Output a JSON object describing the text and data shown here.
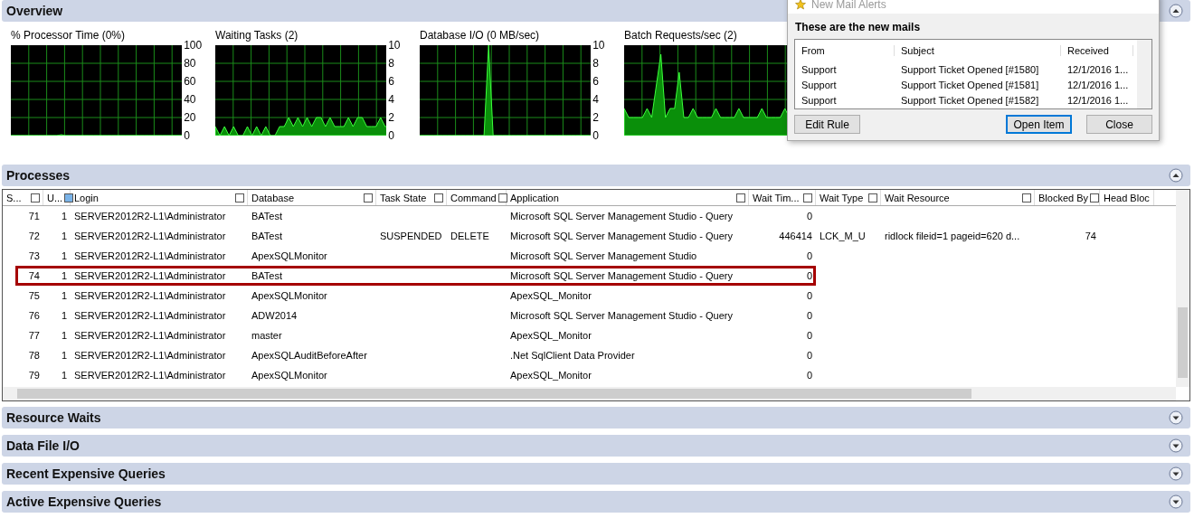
{
  "overview": {
    "title": "Overview",
    "expanded": true,
    "charts": [
      {
        "title": "% Processor Time (0%)",
        "chart_data": {
          "type": "area",
          "grid": true,
          "ylim": [
            0,
            100
          ],
          "yticks": [
            {
              "value": 100,
              "label": "100"
            },
            {
              "value": 80,
              "label": "80"
            },
            {
              "value": 60,
              "label": "60"
            },
            {
              "value": 40,
              "label": "40"
            },
            {
              "value": 20,
              "label": "20"
            },
            {
              "value": 0,
              "label": "0"
            }
          ],
          "values": [
            0,
            0,
            0,
            0,
            0,
            0,
            0,
            0,
            0,
            0,
            0,
            1,
            0,
            0,
            0,
            0,
            0,
            0,
            0,
            0,
            0,
            0,
            0,
            0,
            0,
            0,
            0,
            0,
            0,
            0,
            0,
            0,
            0,
            0,
            0,
            0,
            0,
            0,
            0,
            0
          ]
        }
      },
      {
        "title": "Waiting Tasks (2)",
        "chart_data": {
          "type": "area",
          "grid": true,
          "ylim": [
            0,
            10
          ],
          "yticks": [
            {
              "value": 10,
              "label": "10"
            },
            {
              "value": 8,
              "label": "8"
            },
            {
              "value": 6,
              "label": "6"
            },
            {
              "value": 4,
              "label": "4"
            },
            {
              "value": 2,
              "label": "2"
            },
            {
              "value": 0,
              "label": "0"
            }
          ],
          "values": [
            1,
            0,
            1,
            0,
            1,
            0,
            0,
            1,
            0,
            1,
            0,
            1,
            0,
            0,
            1,
            1,
            2,
            1,
            2,
            1,
            2,
            1,
            2,
            2,
            1,
            2,
            1,
            1,
            1,
            2,
            1,
            2,
            2,
            1,
            1,
            1,
            2,
            1,
            1,
            2
          ]
        }
      },
      {
        "title": "Database I/O (0 MB/sec)",
        "chart_data": {
          "type": "area",
          "grid": true,
          "ylim": [
            0,
            10
          ],
          "yticks": [
            {
              "value": 10,
              "label": "10"
            },
            {
              "value": 8,
              "label": "8"
            },
            {
              "value": 6,
              "label": "6"
            },
            {
              "value": 4,
              "label": "4"
            },
            {
              "value": 2,
              "label": "2"
            },
            {
              "value": 0,
              "label": "0"
            }
          ],
          "values": [
            0,
            0,
            0,
            0,
            0,
            0,
            0,
            0,
            0,
            0,
            0,
            0,
            0,
            0,
            0,
            10,
            0,
            0,
            0,
            0,
            0,
            0,
            0,
            0,
            0,
            0,
            0,
            0,
            0,
            0,
            0,
            0,
            0,
            0,
            0,
            0,
            0,
            0,
            0,
            0
          ]
        }
      },
      {
        "title": "Batch Requests/sec (2)"
      }
    ]
  },
  "processes": {
    "title": "Processes",
    "expanded": true,
    "columns": [
      {
        "label": "S...",
        "filter_active": false
      },
      {
        "label": "U...",
        "filter_active": true
      },
      {
        "label": "Login",
        "filter_active": false
      },
      {
        "label": "Database",
        "filter_active": false
      },
      {
        "label": "Task State",
        "filter_active": false
      },
      {
        "label": "Command",
        "filter_active": false
      },
      {
        "label": "Application",
        "filter_active": false
      },
      {
        "label": "Wait Tim...",
        "filter_active": false
      },
      {
        "label": "Wait Type",
        "filter_active": false
      },
      {
        "label": "Wait Resource",
        "filter_active": false
      },
      {
        "label": "Blocked By",
        "filter_active": false
      },
      {
        "label": "Head Bloc"
      }
    ],
    "rows": [
      {
        "highlighted": false,
        "cells": [
          "71",
          "1",
          "SERVER2012R2-L1\\Administrator",
          "BATest",
          "",
          "",
          "Microsoft SQL Server Management Studio - Query",
          "0",
          "",
          "",
          "",
          ""
        ]
      },
      {
        "highlighted": false,
        "cells": [
          "72",
          "1",
          "SERVER2012R2-L1\\Administrator",
          "BATest",
          "SUSPENDED",
          "DELETE",
          "Microsoft SQL Server Management Studio - Query",
          "446414",
          "LCK_M_U",
          "ridlock fileid=1 pageid=620 d...",
          "74",
          ""
        ]
      },
      {
        "highlighted": false,
        "cells": [
          "73",
          "1",
          "SERVER2012R2-L1\\Administrator",
          "ApexSQLMonitor",
          "",
          "",
          "Microsoft SQL Server Management Studio",
          "0",
          "",
          "",
          "",
          ""
        ]
      },
      {
        "highlighted": true,
        "cells": [
          "74",
          "1",
          "SERVER2012R2-L1\\Administrator",
          "BATest",
          "",
          "",
          "Microsoft SQL Server Management Studio - Query",
          "0",
          "",
          "",
          "",
          ""
        ]
      },
      {
        "highlighted": false,
        "cells": [
          "75",
          "1",
          "SERVER2012R2-L1\\Administrator",
          "ApexSQLMonitor",
          "",
          "",
          "ApexSQL_Monitor",
          "0",
          "",
          "",
          "",
          ""
        ]
      },
      {
        "highlighted": false,
        "cells": [
          "76",
          "1",
          "SERVER2012R2-L1\\Administrator",
          "ADW2014",
          "",
          "",
          "Microsoft SQL Server Management Studio - Query",
          "0",
          "",
          "",
          "",
          ""
        ]
      },
      {
        "highlighted": false,
        "cells": [
          "77",
          "1",
          "SERVER2012R2-L1\\Administrator",
          "master",
          "",
          "",
          "ApexSQL_Monitor",
          "0",
          "",
          "",
          "",
          ""
        ]
      },
      {
        "highlighted": false,
        "cells": [
          "78",
          "1",
          "SERVER2012R2-L1\\Administrator",
          "ApexSQLAuditBeforeAfter",
          "",
          "",
          ".Net SqlClient Data Provider",
          "0",
          "",
          "",
          "",
          ""
        ]
      },
      {
        "highlighted": false,
        "cells": [
          "79",
          "1",
          "SERVER2012R2-L1\\Administrator",
          "ApexSQLMonitor",
          "",
          "",
          "ApexSQL_Monitor",
          "0",
          "",
          "",
          "",
          ""
        ]
      }
    ]
  },
  "collapsed_sections": [
    {
      "title": "Resource Waits",
      "expanded": false
    },
    {
      "title": "Data File I/O",
      "expanded": false
    },
    {
      "title": "Recent Expensive Queries",
      "expanded": false
    },
    {
      "title": "Active Expensive Queries",
      "expanded": false
    }
  ],
  "mail_alert": {
    "title": "New Mail Alerts",
    "heading": "These are the new mails",
    "columns": [
      "From",
      "Subject",
      "Received"
    ],
    "rows": [
      [
        "Support",
        "Support Ticket Opened [#1580]",
        "12/1/2016 1..."
      ],
      [
        "Support",
        "Support Ticket Opened [#1581]",
        "12/1/2016 1..."
      ],
      [
        "Support",
        "Support Ticket Opened [#1582]",
        "12/1/2016 1..."
      ]
    ],
    "buttons": [
      {
        "label": "Edit Rule",
        "default": false
      },
      {
        "label": "Open Item",
        "default": true
      },
      {
        "label": "Close",
        "default": false
      }
    ]
  }
}
